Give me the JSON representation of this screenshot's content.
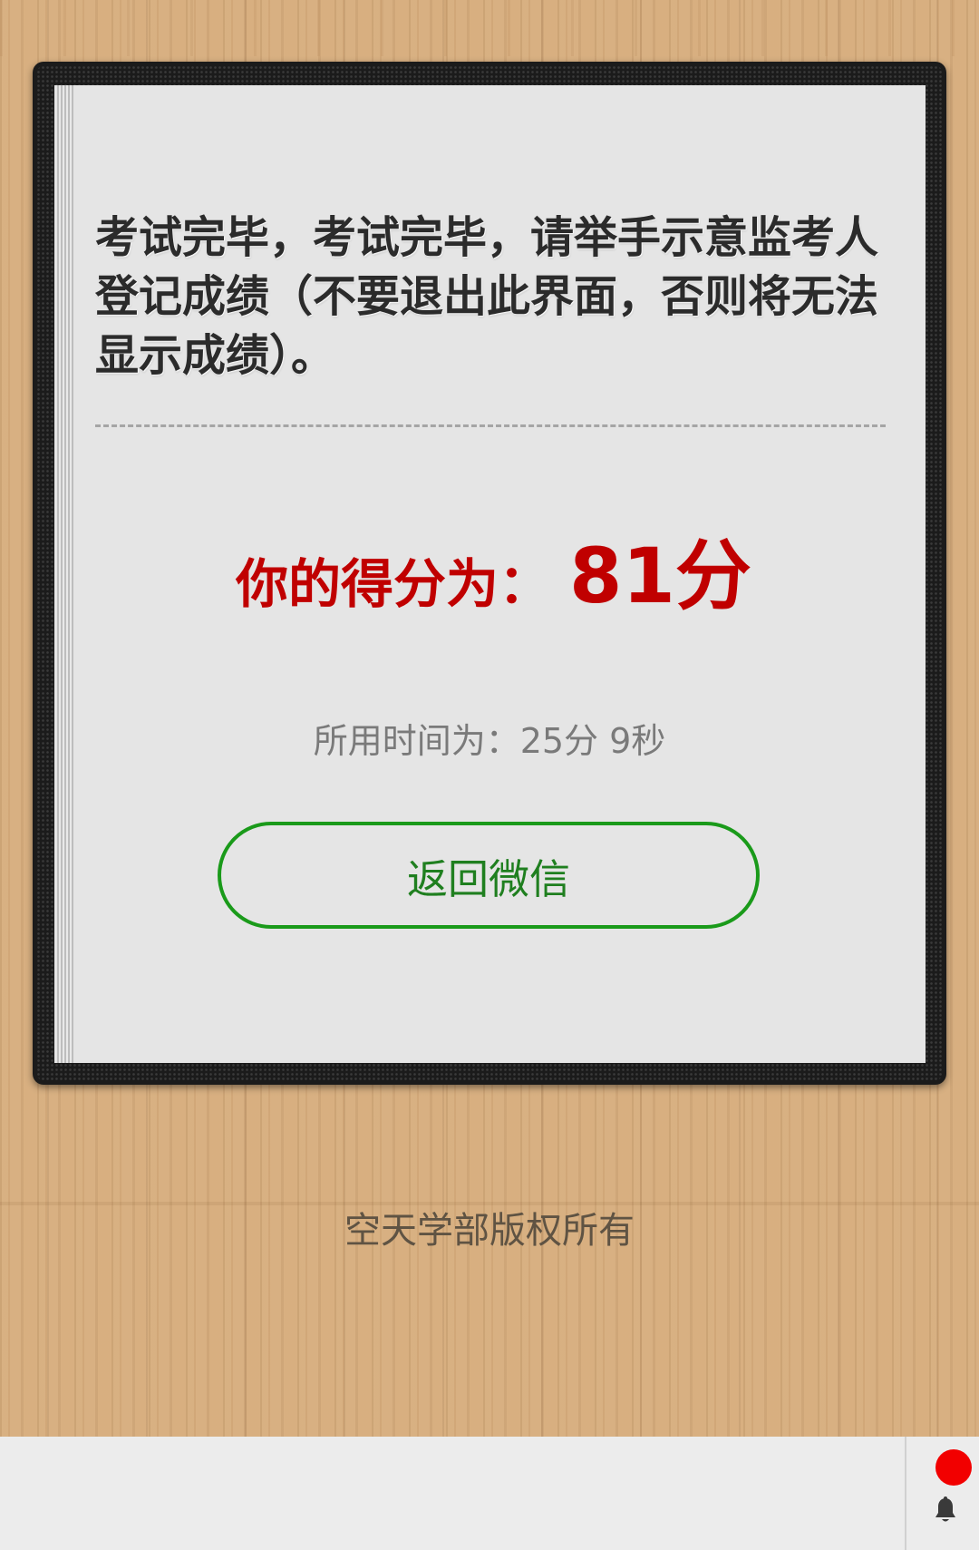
{
  "exam_result": {
    "instruction": "考试完毕，考试完毕，请举手示意监考人登记成绩（不要退出此界面，否则将无法显示成绩）。",
    "score_label": "你的得分为：",
    "score_value": "81分",
    "time_text": "所用时间为：25分 9秒",
    "back_button_label": "返回微信"
  },
  "footer": {
    "copyright": "空天学部版权所有"
  },
  "bottom_bar": {
    "notification_badge_color": "#f20000",
    "icon": "bell-icon"
  },
  "colors": {
    "score": "#c00000",
    "button_border": "#1a9a1a",
    "button_text": "#1f7f1f",
    "paper": "#e5e5e5",
    "frame": "#1b1b1b"
  }
}
